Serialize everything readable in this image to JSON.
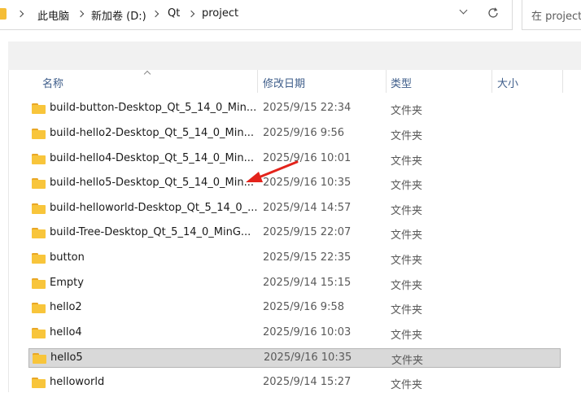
{
  "breadcrumb": {
    "items": [
      "此电脑",
      "新加卷 (D:)",
      "Qt",
      "project"
    ]
  },
  "search": {
    "placeholder": "在 project"
  },
  "columns": {
    "name": "名称",
    "date": "修改日期",
    "type": "类型",
    "size": "大小"
  },
  "files": [
    {
      "name": "build-button-Desktop_Qt_5_14_0_Min...",
      "date": "2025/9/15 22:34",
      "type": "文件夹",
      "selected": false
    },
    {
      "name": "build-hello2-Desktop_Qt_5_14_0_Min...",
      "date": "2025/9/16 9:56",
      "type": "文件夹",
      "selected": false
    },
    {
      "name": "build-hello4-Desktop_Qt_5_14_0_Min...",
      "date": "2025/9/16 10:01",
      "type": "文件夹",
      "selected": false
    },
    {
      "name": "build-hello5-Desktop_Qt_5_14_0_Min...",
      "date": "2025/9/16 10:35",
      "type": "文件夹",
      "selected": false
    },
    {
      "name": "build-helloworld-Desktop_Qt_5_14_0_...",
      "date": "2025/9/14 14:57",
      "type": "文件夹",
      "selected": false
    },
    {
      "name": "build-Tree-Desktop_Qt_5_14_0_MinG...",
      "date": "2025/9/15 22:07",
      "type": "文件夹",
      "selected": false
    },
    {
      "name": "button",
      "date": "2025/9/15 22:35",
      "type": "文件夹",
      "selected": false
    },
    {
      "name": "Empty",
      "date": "2025/9/14 15:15",
      "type": "文件夹",
      "selected": false
    },
    {
      "name": "hello2",
      "date": "2025/9/16 9:58",
      "type": "文件夹",
      "selected": false
    },
    {
      "name": "hello4",
      "date": "2025/9/16 10:03",
      "type": "文件夹",
      "selected": false
    },
    {
      "name": "hello5",
      "date": "2025/9/16 10:35",
      "type": "文件夹",
      "selected": true
    },
    {
      "name": "helloworld",
      "date": "2025/9/14 15:27",
      "type": "文件夹",
      "selected": false
    }
  ],
  "icons": {
    "folder": "folder-icon",
    "chevron": "chevron-right-icon",
    "dropdown": "chevron-down-icon",
    "refresh": "refresh-icon",
    "annotation": "red-arrow-icon"
  },
  "colors": {
    "folder": "#f8c53b",
    "selection": "#d9d9d9",
    "header_text": "#3e5d8a",
    "annotation_arrow": "#e3231b"
  }
}
